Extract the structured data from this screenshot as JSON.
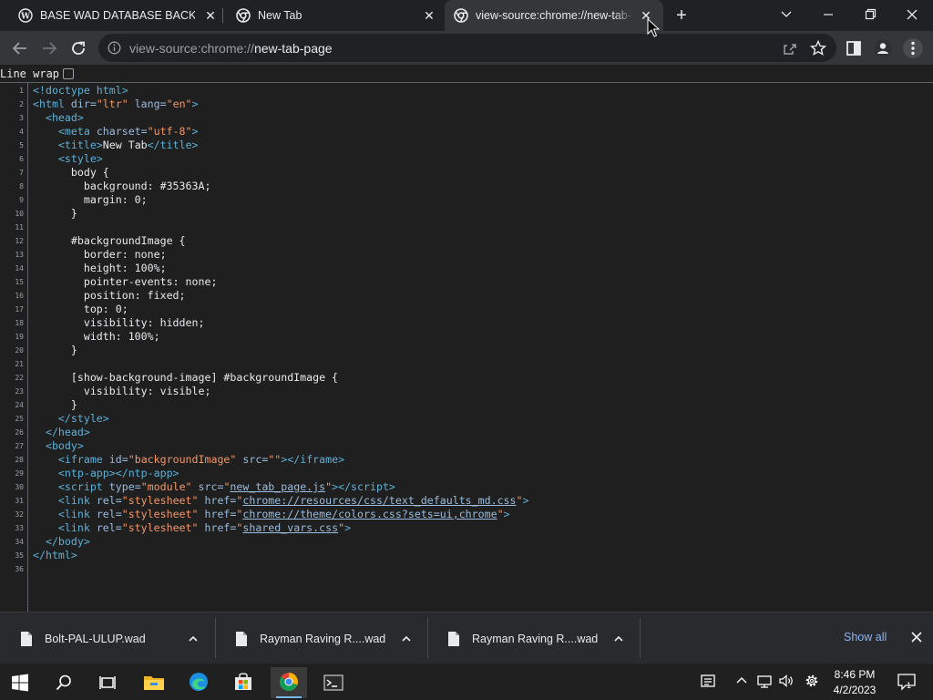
{
  "tabs": [
    {
      "title": "BASE WAD DATABASE BACKUP | WAD",
      "icon": "wordpress-icon",
      "active": false
    },
    {
      "title": "New Tab",
      "icon": "chrome-icon",
      "active": false
    },
    {
      "title": "view-source:chrome://new-tab-page",
      "icon": "chrome-icon",
      "active": true
    }
  ],
  "omnibox": {
    "scheme": "view-source:chrome://",
    "host": "new-tab-page"
  },
  "view_source": {
    "line_wrap_label": "Line wrap",
    "line_wrap_checked": false,
    "lines": [
      {
        "n": "1",
        "html": "<span class=\"t\">&lt;!doctype html&gt;</span>"
      },
      {
        "n": "2",
        "html": "<span class=\"t\">&lt;html</span> <span class=\"an\">dir=</span><span class=\"av\">\"ltr\"</span> <span class=\"an\">lang=</span><span class=\"av\">\"en\"</span><span class=\"t\">&gt;</span>"
      },
      {
        "n": "3",
        "html": "  <span class=\"t\">&lt;head&gt;</span>"
      },
      {
        "n": "4",
        "html": "    <span class=\"t\">&lt;meta</span> <span class=\"an\">charset=</span><span class=\"av\">\"utf-8\"</span><span class=\"t\">&gt;</span>"
      },
      {
        "n": "5",
        "html": "    <span class=\"t\">&lt;title&gt;</span>New Tab<span class=\"t\">&lt;/title&gt;</span>"
      },
      {
        "n": "6",
        "html": "    <span class=\"t\">&lt;style&gt;</span>"
      },
      {
        "n": "7",
        "html": "      body {"
      },
      {
        "n": "8",
        "html": "        background: #35363A;"
      },
      {
        "n": "9",
        "html": "        margin: 0;"
      },
      {
        "n": "10",
        "html": "      }"
      },
      {
        "n": "11",
        "html": ""
      },
      {
        "n": "12",
        "html": "      #backgroundImage {"
      },
      {
        "n": "13",
        "html": "        border: none;"
      },
      {
        "n": "14",
        "html": "        height: 100%;"
      },
      {
        "n": "15",
        "html": "        pointer-events: none;"
      },
      {
        "n": "16",
        "html": "        position: fixed;"
      },
      {
        "n": "17",
        "html": "        top: 0;"
      },
      {
        "n": "18",
        "html": "        visibility: hidden;"
      },
      {
        "n": "19",
        "html": "        width: 100%;"
      },
      {
        "n": "20",
        "html": "      }"
      },
      {
        "n": "21",
        "html": ""
      },
      {
        "n": "22",
        "html": "      [show-background-image] #backgroundImage {"
      },
      {
        "n": "23",
        "html": "        visibility: visible;"
      },
      {
        "n": "24",
        "html": "      }"
      },
      {
        "n": "25",
        "html": "    <span class=\"t\">&lt;/style&gt;</span>"
      },
      {
        "n": "26",
        "html": "  <span class=\"t\">&lt;/head&gt;</span>"
      },
      {
        "n": "27",
        "html": "  <span class=\"t\">&lt;body&gt;</span>"
      },
      {
        "n": "28",
        "html": "    <span class=\"t\">&lt;iframe</span> <span class=\"an\">id=</span><span class=\"av\">\"backgroundImage\"</span> <span class=\"an\">src=</span><span class=\"av\">\"\"</span><span class=\"t\">&gt;&lt;/iframe&gt;</span>"
      },
      {
        "n": "29",
        "html": "    <span class=\"t\">&lt;ntp-app&gt;&lt;/ntp-app&gt;</span>"
      },
      {
        "n": "30",
        "html": "    <span class=\"t\">&lt;script</span> <span class=\"an\">type=</span><span class=\"av\">\"module\"</span> <span class=\"an\">src=</span><span class=\"av\">\"</span><span class=\"lk\">new_tab_page.js</span><span class=\"av\">\"</span><span class=\"t\">&gt;&lt;/script&gt;</span>"
      },
      {
        "n": "31",
        "html": "    <span class=\"t\">&lt;link</span> <span class=\"an\">rel=</span><span class=\"av\">\"stylesheet\"</span> <span class=\"an\">href=</span><span class=\"av\">\"</span><span class=\"lk\">chrome://resources/css/text_defaults_md.css</span><span class=\"av\">\"</span><span class=\"t\">&gt;</span>"
      },
      {
        "n": "32",
        "html": "    <span class=\"t\">&lt;link</span> <span class=\"an\">rel=</span><span class=\"av\">\"stylesheet\"</span> <span class=\"an\">href=</span><span class=\"av\">\"</span><span class=\"lk\">chrome://theme/colors.css?sets=ui,chrome</span><span class=\"av\">\"</span><span class=\"t\">&gt;</span>"
      },
      {
        "n": "33",
        "html": "    <span class=\"t\">&lt;link</span> <span class=\"an\">rel=</span><span class=\"av\">\"stylesheet\"</span> <span class=\"an\">href=</span><span class=\"av\">\"</span><span class=\"lk\">shared_vars.css</span><span class=\"av\">\"</span><span class=\"t\">&gt;</span>"
      },
      {
        "n": "34",
        "html": "  <span class=\"t\">&lt;/body&gt;</span>"
      },
      {
        "n": "35",
        "html": "<span class=\"t\">&lt;/html&gt;</span>"
      },
      {
        "n": "36",
        "html": ""
      }
    ]
  },
  "downloads": {
    "items": [
      {
        "name": "Bolt-PAL-ULUP.wad",
        "icon": "file-icon"
      },
      {
        "name": "Rayman Raving R....wad",
        "icon": "file-icon"
      },
      {
        "name": "Rayman Raving R....wad",
        "icon": "file-icon"
      }
    ],
    "show_all": "Show all"
  },
  "taskbar": {
    "apps": [
      "start-icon",
      "search-icon",
      "task-view-icon",
      "file-explorer-icon",
      "edge-icon",
      "store-icon",
      "chrome-icon",
      "terminal-icon"
    ],
    "time": "8:46 PM",
    "date": "4/2/2023",
    "notification_count": "1"
  },
  "colors": {
    "tag": "#5db0d7",
    "attr_name": "#9bbbdc",
    "attr_value": "#f29766",
    "accent": "#8ab4f8"
  }
}
